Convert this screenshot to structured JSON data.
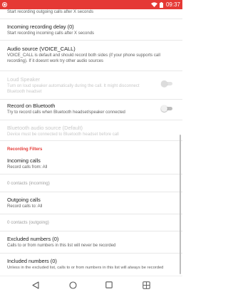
{
  "status_bar": {
    "time": "09:37",
    "icons": [
      "record-icon",
      "wifi-icon",
      "battery-icon"
    ]
  },
  "settings": {
    "outgoing_delay_summary": "Start recording outgoing calls after X seconds",
    "incoming_delay": {
      "title": "Incoming recording delay (0)",
      "summary": "Start recording incoming calls after X seconds"
    },
    "audio_source": {
      "title": "Audio source (VOICE_CALL)",
      "summary": "VOICE_CALL is default and should record both sides (if your phone supports call recording). If it doesnt work try other audio sources"
    },
    "loud_speaker": {
      "title": "Loud Speaker",
      "summary": "Turn on loud speaker automatically during the call. It might disconnect Bluetooth headset",
      "enabled": false
    },
    "record_on_bluetooth": {
      "title": "Record on Bluetooth",
      "summary": "Try to record calls when Bluetooth headset/speaker connected",
      "enabled": false
    },
    "bluetooth_audio_source": {
      "title": "Bluetooth audio source (Default)",
      "summary": "Device must be connected to Bluetooth headset before call"
    }
  },
  "recording_filters": {
    "header": "Recording Filters",
    "incoming_calls": {
      "title": "Incoming calls",
      "summary": "Record calls from: All"
    },
    "incoming_contacts": "0 contacts (incoming)",
    "outgoing_calls": {
      "title": "Outgoing calls",
      "summary": "Record calls to: All"
    },
    "outgoing_contacts": "0 contacts (outgoing)",
    "excluded_numbers": {
      "title": "Excluded numbers (0)",
      "summary": "Calls to or from numbers in this list will never be recorded"
    },
    "included_numbers": {
      "title": "Included numbers (0)",
      "summary": "Unless in the excluded list, calls to or from numbers in this list will always be recorded"
    }
  },
  "colors": {
    "accent": "#e53935",
    "status_bar": "#e53935"
  },
  "nav_bar": {
    "buttons": [
      "back-icon",
      "home-icon",
      "recents-icon",
      "screenshot-icon"
    ]
  }
}
